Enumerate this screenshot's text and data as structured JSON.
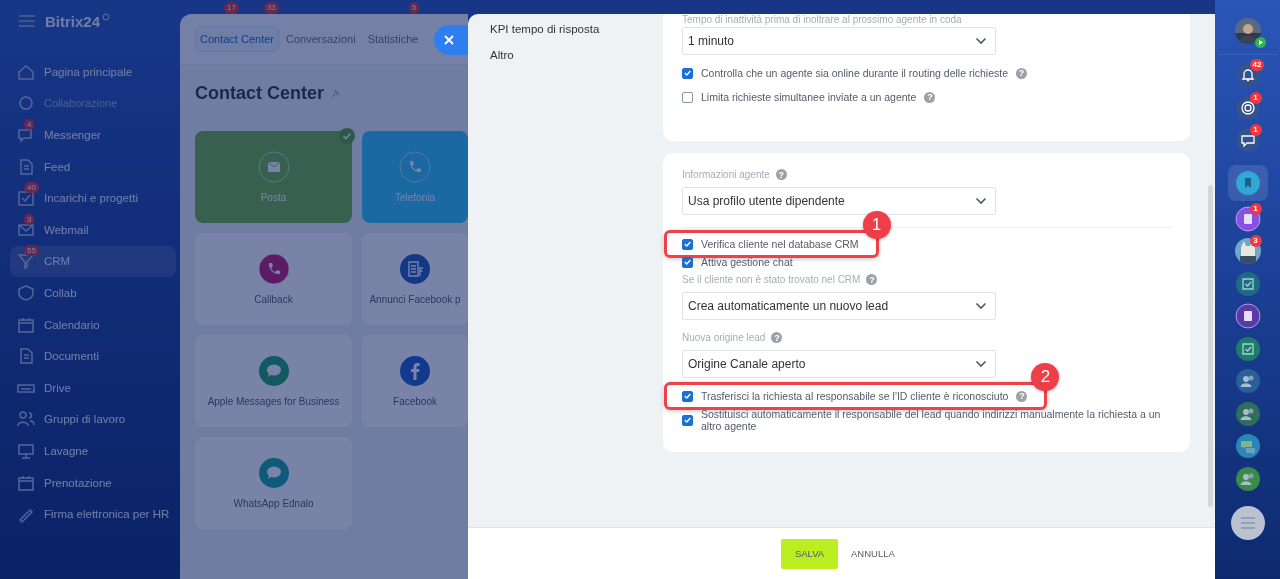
{
  "top_badges": [
    "17",
    "33",
    "5"
  ],
  "sidebar": {
    "logo": "Bitrix24",
    "items": [
      {
        "label": "Pagina principale",
        "kind": "item",
        "selected": false
      },
      {
        "label": "Collaborazione",
        "kind": "group",
        "selected": false
      },
      {
        "label": "Messenger",
        "kind": "item",
        "badge": "4",
        "selected": false
      },
      {
        "label": "Feed",
        "kind": "item",
        "selected": false
      },
      {
        "label": "Incarichi e progetti",
        "kind": "item",
        "badge": "40",
        "selected": false
      },
      {
        "label": "Webmail",
        "kind": "item",
        "badge": "3",
        "selected": false
      },
      {
        "label": "CRM",
        "kind": "item",
        "badge": "55",
        "selected": true
      },
      {
        "label": "Collab",
        "kind": "item",
        "selected": false
      },
      {
        "label": "Calendario",
        "kind": "item",
        "selected": false
      },
      {
        "label": "Documenti",
        "kind": "item",
        "selected": false
      },
      {
        "label": "Drive",
        "kind": "item",
        "selected": false
      },
      {
        "label": "Gruppi di lavoro",
        "kind": "item",
        "selected": false
      },
      {
        "label": "Lavagne",
        "kind": "item",
        "selected": false
      },
      {
        "label": "Prenotazione",
        "kind": "item",
        "selected": false
      },
      {
        "label": "Firma elettronica per HR",
        "kind": "item",
        "selected": false
      }
    ]
  },
  "contact_center": {
    "tabs": [
      {
        "label": "Contact Center",
        "selected": true
      },
      {
        "label": "Conversazioni",
        "selected": false
      },
      {
        "label": "Statistiche",
        "selected": false
      }
    ],
    "title": "Contact Center",
    "tiles": [
      {
        "label": "Posta",
        "kind": "mail",
        "filled": true,
        "connected": true
      },
      {
        "label": "Telefonia",
        "kind": "telephony",
        "filled": true,
        "connected": false
      },
      {
        "label": "Callback",
        "kind": "callback",
        "filled": false,
        "connected": false
      },
      {
        "label": "Annunci Facebook p",
        "kind": "ads",
        "filled": false,
        "connected": false
      },
      {
        "label": "Apple Messages for Business",
        "kind": "apple",
        "filled": false,
        "connected": false
      },
      {
        "label": "Facebook",
        "kind": "facebook",
        "filled": false,
        "connected": false
      },
      {
        "label": "WhatsApp Ednalo",
        "kind": "whatsapp",
        "filled": false,
        "connected": false
      }
    ]
  },
  "settings": {
    "nav": [
      {
        "label": "KPI tempo di risposta"
      },
      {
        "label": "Altro"
      }
    ],
    "sections": [
      {
        "fields": [
          {
            "kind": "label",
            "text": "Tempo di inattività prima di inoltrare al prossimo agente in coda"
          },
          {
            "kind": "select",
            "value": "1 minuto"
          },
          {
            "kind": "checkbox",
            "label": "Controlla che un agente sia online durante il routing delle richieste",
            "checked": true,
            "help": "?"
          },
          {
            "kind": "checkbox",
            "label": "Limita richieste simultanee inviate a un agente",
            "checked": false,
            "help": "?"
          }
        ]
      },
      {
        "fields": [
          {
            "kind": "label",
            "text": "Informazioni agente",
            "help": "?"
          },
          {
            "kind": "select",
            "value": "Usa profilo utente dipendente"
          },
          {
            "kind": "divider"
          },
          {
            "kind": "checkbox",
            "label": "Verifica cliente nel database CRM",
            "checked": true,
            "annotation": "1"
          },
          {
            "kind": "checkbox",
            "label": "Attiva gestione chat",
            "checked": true
          },
          {
            "kind": "label",
            "text": "Se il cliente non è stato trovato nel CRM",
            "help": "?"
          },
          {
            "kind": "select",
            "value": "Crea automaticamente un nuovo lead"
          },
          {
            "kind": "label",
            "text": "Nuova origine lead",
            "help": "?"
          },
          {
            "kind": "select",
            "value": "Origine Canale aperto"
          },
          {
            "kind": "checkbox",
            "label": "Trasferisci la richiesta al responsabile se l'ID cliente è riconosciuto",
            "checked": true,
            "help": "?",
            "annotation": "2"
          },
          {
            "kind": "checkbox",
            "label": "Sostituisci automaticamente il responsabile del lead quando indirizzi manualmente la richiesta a un altro agente",
            "checked": true
          }
        ]
      }
    ]
  },
  "footer": {
    "buttons": [
      {
        "label": "SALVA",
        "kind": "primary"
      },
      {
        "label": "ANNULLA",
        "kind": "link"
      }
    ]
  },
  "rail": [
    {
      "kind": "avatar",
      "selected": false
    },
    {
      "kind": "bell",
      "badge": "42",
      "selected": false
    },
    {
      "kind": "target",
      "badge": "1",
      "selected": false
    },
    {
      "kind": "chat",
      "badge": "1",
      "selected": false
    },
    {
      "kind": "bookmark",
      "color": "#2fa8d8",
      "selected": true
    },
    {
      "kind": "contact",
      "color": "#8a4fe6",
      "badge": "1",
      "selected": false
    },
    {
      "badge": "3",
      "selected": false
    },
    {
      "kind": "task",
      "color": "#1f6b86",
      "selected": false
    },
    {
      "kind": "contact",
      "color": "#5a3aa8",
      "selected": false
    },
    {
      "kind": "task",
      "color": "#1f7a6a",
      "selected": false
    },
    {
      "kind": "people",
      "color": "#2a5f9a",
      "selected": false
    },
    {
      "kind": "people",
      "color": "#2f6d5c",
      "selected": false
    },
    {
      "kind": "messages",
      "color": "#2b86b8",
      "selected": false
    },
    {
      "kind": "people",
      "color": "#3a8a48",
      "selected": false
    },
    {
      "kind": "menu",
      "selected": false
    }
  ]
}
